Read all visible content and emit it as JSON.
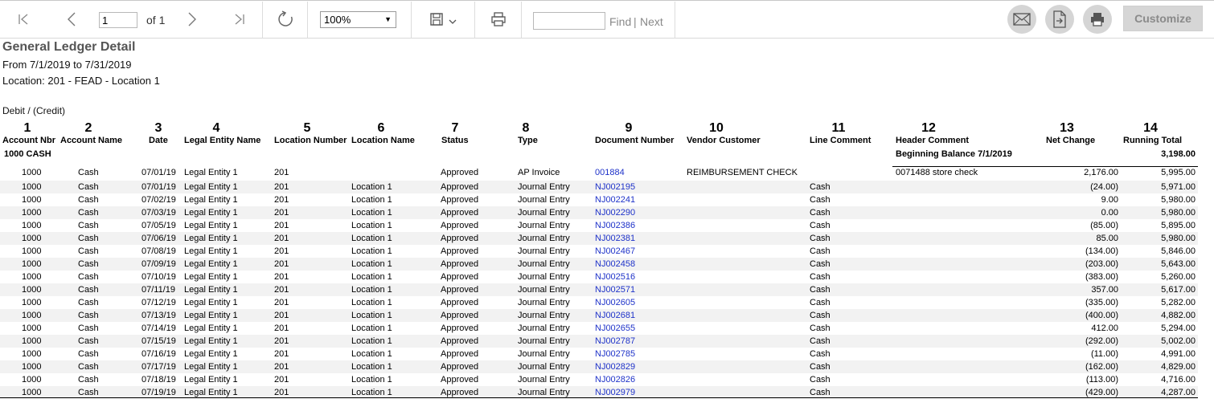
{
  "toolbar": {
    "page_value": "1",
    "page_of": "of 1",
    "zoom": "100%",
    "find_label": "Find",
    "find_sep": "|",
    "next_label": "Next",
    "customize_label": "Customize"
  },
  "report": {
    "title": "General Ledger Detail",
    "date_range": "From 7/1/2019 to 7/31/2019",
    "location": "Location: 201 - FEAD - Location 1",
    "debit_credit": "Debit / (Credit)"
  },
  "columns": [
    {
      "num": "1",
      "name": "Account Nbr"
    },
    {
      "num": "2",
      "name": "Account Name"
    },
    {
      "num": "3",
      "name": "Date"
    },
    {
      "num": "4",
      "name": "Legal Entity Name"
    },
    {
      "num": "5",
      "name": "Location Number"
    },
    {
      "num": "6",
      "name": "Location Name"
    },
    {
      "num": "7",
      "name": "Status"
    },
    {
      "num": "8",
      "name": "Type"
    },
    {
      "num": "9",
      "name": "Document Number"
    },
    {
      "num": "10",
      "name": "Vendor Customer"
    },
    {
      "num": "11",
      "name": "Line Comment"
    },
    {
      "num": "12",
      "name": "Header Comment"
    },
    {
      "num": "13",
      "name": "Net Change"
    },
    {
      "num": "14",
      "name": "Running Total"
    }
  ],
  "group": {
    "label": "1000 CASH",
    "beginning_label": "Beginning Balance 7/1/2019",
    "beginning_value": "3,198.00"
  },
  "rows": [
    {
      "acct": "1000",
      "name": "Cash",
      "date": "07/01/19",
      "entity": "Legal Entity 1",
      "locnum": "201",
      "locname": "",
      "status": "Approved",
      "type": "AP Invoice",
      "doc": "001884",
      "vendor": "REIMBURSEMENT CHECK",
      "line": "",
      "header": "0071488  store check",
      "net": "2,176.00",
      "total": "5,995.00"
    },
    {
      "acct": "1000",
      "name": "Cash",
      "date": "07/01/19",
      "entity": "Legal Entity 1",
      "locnum": "201",
      "locname": "Location 1",
      "status": "Approved",
      "type": "Journal Entry",
      "doc": "NJ002195",
      "vendor": "",
      "line": "Cash",
      "header": "",
      "net": "(24.00)",
      "total": "5,971.00"
    },
    {
      "acct": "1000",
      "name": "Cash",
      "date": "07/02/19",
      "entity": "Legal Entity 1",
      "locnum": "201",
      "locname": "Location 1",
      "status": "Approved",
      "type": "Journal Entry",
      "doc": "NJ002241",
      "vendor": "",
      "line": "Cash",
      "header": "",
      "net": "9.00",
      "total": "5,980.00"
    },
    {
      "acct": "1000",
      "name": "Cash",
      "date": "07/03/19",
      "entity": "Legal Entity 1",
      "locnum": "201",
      "locname": "Location 1",
      "status": "Approved",
      "type": "Journal Entry",
      "doc": "NJ002290",
      "vendor": "",
      "line": "Cash",
      "header": "",
      "net": "0.00",
      "total": "5,980.00"
    },
    {
      "acct": "1000",
      "name": "Cash",
      "date": "07/05/19",
      "entity": "Legal Entity 1",
      "locnum": "201",
      "locname": "Location 1",
      "status": "Approved",
      "type": "Journal Entry",
      "doc": "NJ002386",
      "vendor": "",
      "line": "Cash",
      "header": "",
      "net": "(85.00)",
      "total": "5,895.00"
    },
    {
      "acct": "1000",
      "name": "Cash",
      "date": "07/06/19",
      "entity": "Legal Entity 1",
      "locnum": "201",
      "locname": "Location 1",
      "status": "Approved",
      "type": "Journal Entry",
      "doc": "NJ002381",
      "vendor": "",
      "line": "Cash",
      "header": "",
      "net": "85.00",
      "total": "5,980.00"
    },
    {
      "acct": "1000",
      "name": "Cash",
      "date": "07/08/19",
      "entity": "Legal Entity 1",
      "locnum": "201",
      "locname": "Location 1",
      "status": "Approved",
      "type": "Journal Entry",
      "doc": "NJ002467",
      "vendor": "",
      "line": "Cash",
      "header": "",
      "net": "(134.00)",
      "total": "5,846.00"
    },
    {
      "acct": "1000",
      "name": "Cash",
      "date": "07/09/19",
      "entity": "Legal Entity 1",
      "locnum": "201",
      "locname": "Location 1",
      "status": "Approved",
      "type": "Journal Entry",
      "doc": "NJ002458",
      "vendor": "",
      "line": "Cash",
      "header": "",
      "net": "(203.00)",
      "total": "5,643.00"
    },
    {
      "acct": "1000",
      "name": "Cash",
      "date": "07/10/19",
      "entity": "Legal Entity 1",
      "locnum": "201",
      "locname": "Location 1",
      "status": "Approved",
      "type": "Journal Entry",
      "doc": "NJ002516",
      "vendor": "",
      "line": "Cash",
      "header": "",
      "net": "(383.00)",
      "total": "5,260.00"
    },
    {
      "acct": "1000",
      "name": "Cash",
      "date": "07/11/19",
      "entity": "Legal Entity 1",
      "locnum": "201",
      "locname": "Location 1",
      "status": "Approved",
      "type": "Journal Entry",
      "doc": "NJ002571",
      "vendor": "",
      "line": "Cash",
      "header": "",
      "net": "357.00",
      "total": "5,617.00"
    },
    {
      "acct": "1000",
      "name": "Cash",
      "date": "07/12/19",
      "entity": "Legal Entity 1",
      "locnum": "201",
      "locname": "Location 1",
      "status": "Approved",
      "type": "Journal Entry",
      "doc": "NJ002605",
      "vendor": "",
      "line": "Cash",
      "header": "",
      "net": "(335.00)",
      "total": "5,282.00"
    },
    {
      "acct": "1000",
      "name": "Cash",
      "date": "07/13/19",
      "entity": "Legal Entity 1",
      "locnum": "201",
      "locname": "Location 1",
      "status": "Approved",
      "type": "Journal Entry",
      "doc": "NJ002681",
      "vendor": "",
      "line": "Cash",
      "header": "",
      "net": "(400.00)",
      "total": "4,882.00"
    },
    {
      "acct": "1000",
      "name": "Cash",
      "date": "07/14/19",
      "entity": "Legal Entity 1",
      "locnum": "201",
      "locname": "Location 1",
      "status": "Approved",
      "type": "Journal Entry",
      "doc": "NJ002655",
      "vendor": "",
      "line": "Cash",
      "header": "",
      "net": "412.00",
      "total": "5,294.00"
    },
    {
      "acct": "1000",
      "name": "Cash",
      "date": "07/15/19",
      "entity": "Legal Entity 1",
      "locnum": "201",
      "locname": "Location 1",
      "status": "Approved",
      "type": "Journal Entry",
      "doc": "NJ002787",
      "vendor": "",
      "line": "Cash",
      "header": "",
      "net": "(292.00)",
      "total": "5,002.00"
    },
    {
      "acct": "1000",
      "name": "Cash",
      "date": "07/16/19",
      "entity": "Legal Entity 1",
      "locnum": "201",
      "locname": "Location 1",
      "status": "Approved",
      "type": "Journal Entry",
      "doc": "NJ002785",
      "vendor": "",
      "line": "Cash",
      "header": "",
      "net": "(11.00)",
      "total": "4,991.00"
    },
    {
      "acct": "1000",
      "name": "Cash",
      "date": "07/17/19",
      "entity": "Legal Entity 1",
      "locnum": "201",
      "locname": "Location 1",
      "status": "Approved",
      "type": "Journal Entry",
      "doc": "NJ002829",
      "vendor": "",
      "line": "Cash",
      "header": "",
      "net": "(162.00)",
      "total": "4,829.00"
    },
    {
      "acct": "1000",
      "name": "Cash",
      "date": "07/18/19",
      "entity": "Legal Entity 1",
      "locnum": "201",
      "locname": "Location 1",
      "status": "Approved",
      "type": "Journal Entry",
      "doc": "NJ002826",
      "vendor": "",
      "line": "Cash",
      "header": "",
      "net": "(113.00)",
      "total": "4,716.00"
    },
    {
      "acct": "1000",
      "name": "Cash",
      "date": "07/19/19",
      "entity": "Legal Entity 1",
      "locnum": "201",
      "locname": "Location 1",
      "status": "Approved",
      "type": "Journal Entry",
      "doc": "NJ002979",
      "vendor": "",
      "line": "Cash",
      "header": "",
      "net": "(429.00)",
      "total": "4,287.00"
    }
  ]
}
